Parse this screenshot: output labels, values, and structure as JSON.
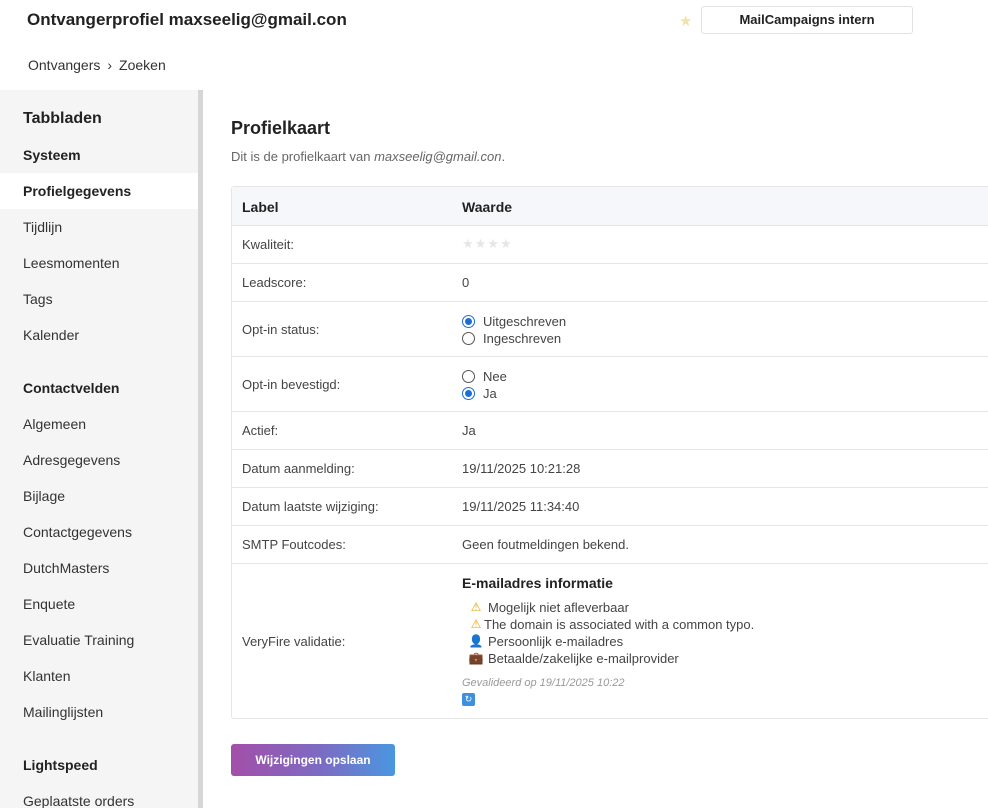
{
  "header": {
    "title": "Ontvangerprofiel maxseelig@gmail.con",
    "workspace_button": "MailCampaigns intern",
    "star_icon": "star-icon"
  },
  "breadcrumb": {
    "items": [
      "Ontvangers",
      "Zoeken"
    ],
    "separator": "›"
  },
  "sidebar": {
    "heading_tabs": "Tabbladen",
    "heading_system": "Systeem",
    "system_items": [
      "Profielgegevens",
      "Tijdlijn",
      "Leesmomenten",
      "Tags",
      "Kalender"
    ],
    "active_item": "Profielgegevens",
    "heading_contactfields": "Contactvelden",
    "contact_items": [
      "Algemeen",
      "Adresgegevens",
      "Bijlage",
      "Contactgegevens",
      "DutchMasters",
      "Enquete",
      "Evaluatie Training",
      "Klanten",
      "Mailinglijsten"
    ],
    "heading_lightspeed": "Lightspeed",
    "lightspeed_items": [
      "Geplaatste orders"
    ]
  },
  "content": {
    "title": "Profielkaart",
    "subtitle_prefix": "Dit is de profielkaart van ",
    "subtitle_email": "maxseelig@gmail.con",
    "subtitle_suffix": "."
  },
  "table": {
    "col_label": "Label",
    "col_value": "Waarde",
    "quality_label": "Kwaliteit:",
    "quality_stars": "★★★★",
    "leadscore_label": "Leadscore:",
    "leadscore_value": "0",
    "optin_status_label": "Opt-in status:",
    "optin_status_options": [
      "Uitgeschreven",
      "Ingeschreven"
    ],
    "optin_status_selected": "Uitgeschreven",
    "optin_confirmed_label": "Opt-in bevestigd:",
    "optin_confirmed_options": [
      "Nee",
      "Ja"
    ],
    "optin_confirmed_selected": "Ja",
    "active_label": "Actief:",
    "active_value": "Ja",
    "signup_label": "Datum aanmelding:",
    "signup_value": "19/11/2025 10:21:28",
    "modified_label": "Datum laatste wijziging:",
    "modified_value": "19/11/2025 11:34:40",
    "smtp_label": "SMTP Foutcodes:",
    "smtp_value": "Geen foutmeldingen bekend.",
    "veryfire_label": "VeryFire validatie:",
    "veryfire": {
      "title": "E-mailadres informatie",
      "lines": [
        {
          "icon": "warning-icon",
          "glyph": "⚠",
          "text": "Mogelijk niet afleverbaar"
        },
        {
          "icon": "warning-icon",
          "glyph": "⚠",
          "text": "The domain is associated with a common typo."
        },
        {
          "icon": "person-icon",
          "glyph": "👤",
          "text": "Persoonlijk e-mailadres"
        },
        {
          "icon": "briefcase-icon",
          "glyph": "💼",
          "text": "Betaalde/zakelijke e-mailprovider"
        }
      ],
      "validated": "Gevalideerd op 19/11/2025 10:22",
      "refresh_glyph": "↻"
    }
  },
  "actions": {
    "save_label": "Wijzigingen opslaan"
  },
  "colors": {
    "accent_blue": "#1a6fd6",
    "button_gradient_start": "#a34fa8",
    "button_gradient_end": "#4a97e0"
  }
}
